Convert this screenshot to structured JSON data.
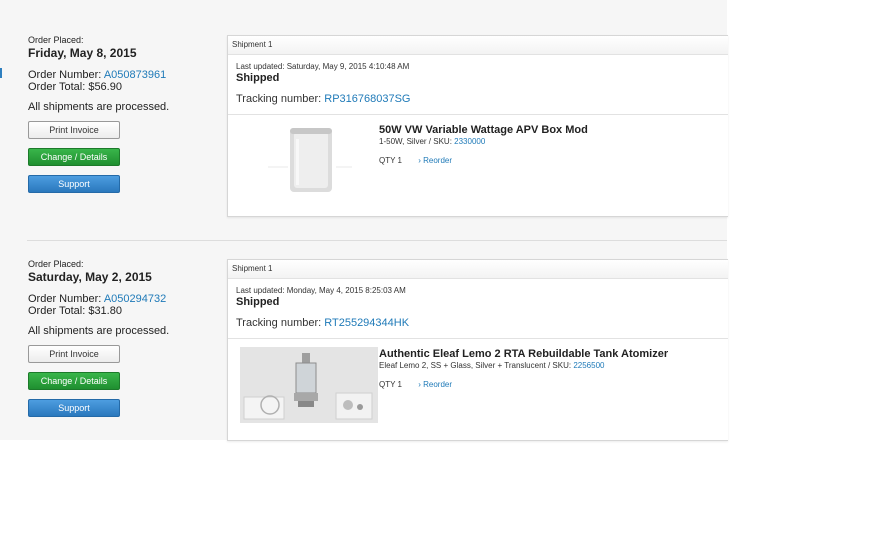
{
  "orders": [
    {
      "placed_label": "Order Placed:",
      "placed_date": "Friday, May 8, 2015",
      "order_number_label": "Order Number:",
      "order_number": "A050873961",
      "order_total": "Order Total: $56.90",
      "processed": "All shipments are processed.",
      "print_label": "Print Invoice",
      "change_label": "Change / Details",
      "support_label": "Support",
      "shipment": {
        "label": "Shipment 1",
        "last_updated": "Last updated: Saturday, May 9, 2015 4:10:48 AM",
        "status": "Shipped",
        "tracking_label": "Tracking number:",
        "tracking_number": "RP316768037SG"
      },
      "item": {
        "title": "50W VW Variable Wattage APV Box Mod",
        "sub": "1-50W, Silver / SKU:",
        "sku": "2330000",
        "qty": "QTY 1",
        "reorder": "› Reorder"
      }
    },
    {
      "placed_label": "Order Placed:",
      "placed_date": "Saturday, May 2, 2015",
      "order_number_label": "Order Number:",
      "order_number": "A050294732",
      "order_total": "Order Total: $31.80",
      "processed": "All shipments are processed.",
      "print_label": "Print Invoice",
      "change_label": "Change / Details",
      "support_label": "Support",
      "shipment": {
        "label": "Shipment 1",
        "last_updated": "Last updated: Monday, May 4, 2015 8:25:03 AM",
        "status": "Shipped",
        "tracking_label": "Tracking number:",
        "tracking_number": "RT255294344HK"
      },
      "item": {
        "title": "Authentic Eleaf Lemo 2 RTA Rebuildable Tank Atomizer",
        "sub": "Eleaf Lemo 2, SS + Glass, Silver + Translucent / SKU:",
        "sku": "2256500",
        "qty": "QTY 1",
        "reorder": "› Reorder"
      }
    }
  ],
  "colors": {
    "link": "#1f7ab8",
    "change_button": "#2ea33e",
    "support_button": "#3a8ad0"
  }
}
